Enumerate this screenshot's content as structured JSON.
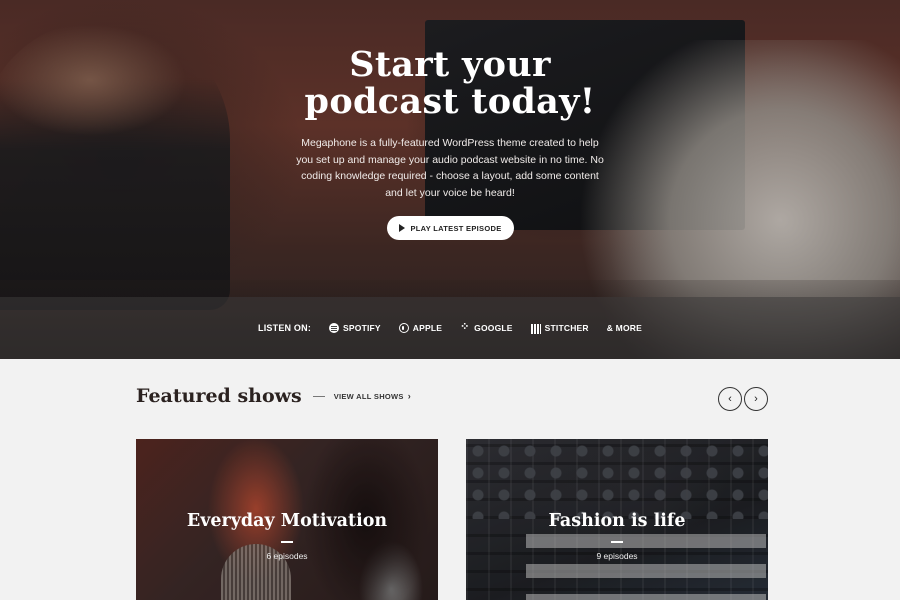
{
  "hero": {
    "title": "Start your podcast today!",
    "description": "Megaphone is a fully-featured WordPress theme created to help you set up and manage your audio podcast website in no time. No coding knowledge required - choose a layout, add some content and let your voice be heard!",
    "play_button": "PLAY LATEST EPISODE"
  },
  "listen_bar": {
    "label": "LISTEN ON:",
    "platforms": [
      {
        "label": "SPOTIFY",
        "icon": "spotify-icon"
      },
      {
        "label": "APPLE",
        "icon": "apple-podcasts-icon"
      },
      {
        "label": "GOOGLE",
        "icon": "google-podcasts-icon"
      },
      {
        "label": "STITCHER",
        "icon": "stitcher-icon"
      },
      {
        "label": "& MORE",
        "icon": ""
      }
    ]
  },
  "featured": {
    "title": "Featured shows",
    "view_all": "VIEW ALL SHOWS",
    "prev_icon": "‹",
    "next_icon": "›",
    "shows": [
      {
        "title": "Everyday Motivation",
        "episodes": "6 episodes"
      },
      {
        "title": "Fashion is life",
        "episodes": "9 episodes"
      }
    ]
  },
  "colors": {
    "hero_overlay": "#4a2a25",
    "text_dark": "#2b2220",
    "background": "#f2f2f2"
  }
}
